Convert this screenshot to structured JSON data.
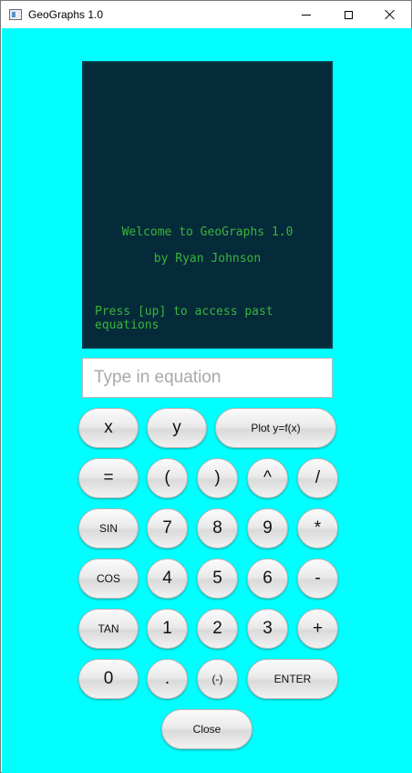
{
  "window": {
    "title": "GeoGraphs 1.0",
    "background_color": "#00ffff"
  },
  "screen": {
    "line1": "Welcome to GeoGraphs 1.0",
    "line2": "by Ryan Johnson",
    "line3": "Press [up] to access past equations",
    "bg_color": "#052b3a",
    "text_color": "#3bb33a"
  },
  "equation": {
    "placeholder": "Type in equation",
    "value": ""
  },
  "keys": {
    "x": "x",
    "y": "y",
    "plot": "Plot y=f(x)",
    "equals": "=",
    "lparen": "(",
    "rparen": ")",
    "caret": "^",
    "slash": "/",
    "sin": "SIN",
    "seven": "7",
    "eight": "8",
    "nine": "9",
    "star": "*",
    "cos": "COS",
    "four": "4",
    "five": "5",
    "six": "6",
    "minus": "-",
    "tan": "TAN",
    "one": "1",
    "two": "2",
    "three": "3",
    "plus": "+",
    "zero": "0",
    "dot": ".",
    "neg": "(-)",
    "enter": "ENTER",
    "close": "Close"
  }
}
